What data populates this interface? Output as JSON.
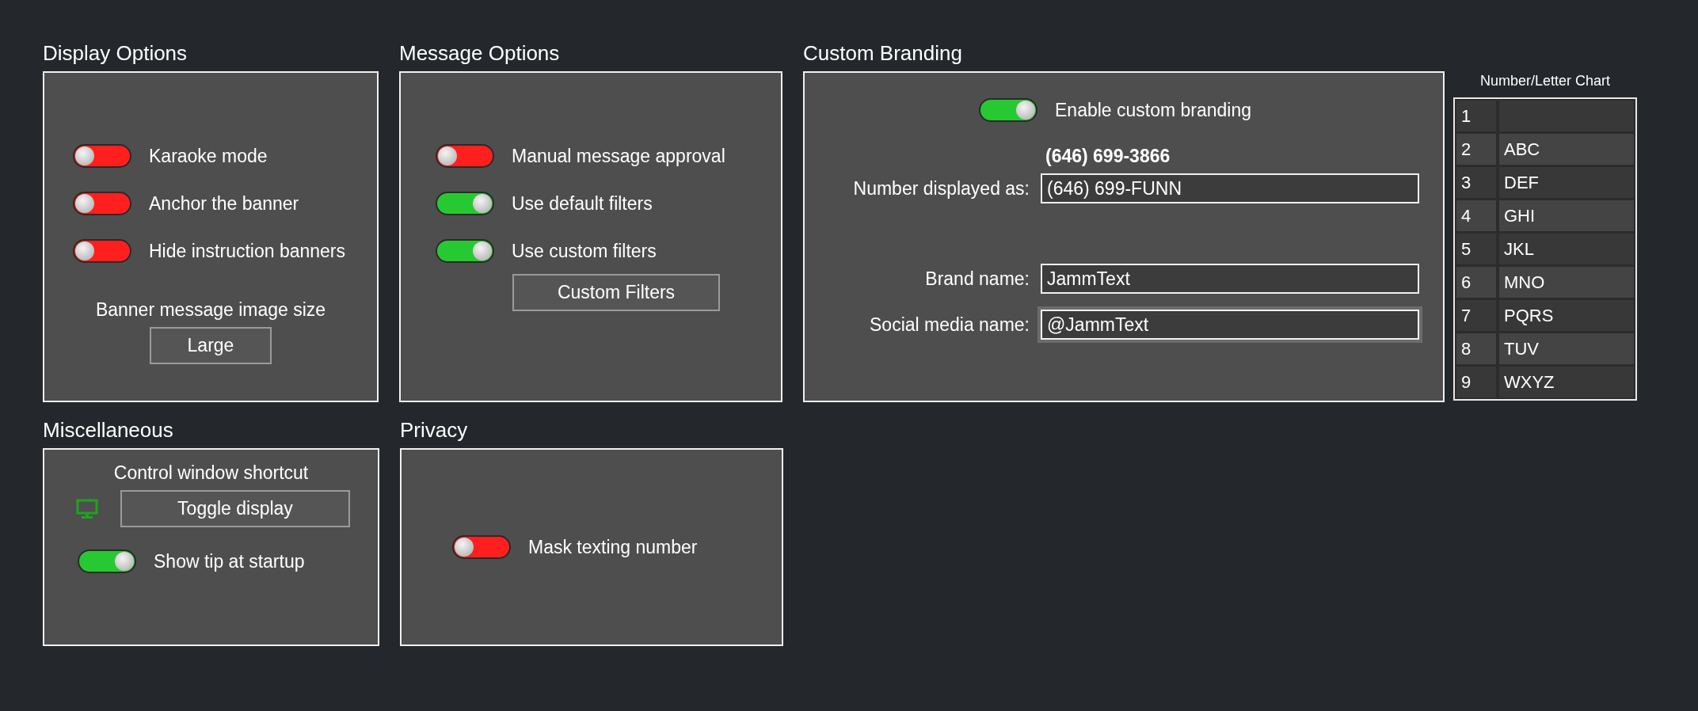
{
  "display_options": {
    "title": "Display Options",
    "toggles": [
      {
        "label": "Karaoke mode",
        "on": false
      },
      {
        "label": "Anchor the banner",
        "on": false
      },
      {
        "label": "Hide instruction banners",
        "on": false
      }
    ],
    "image_size": {
      "label": "Banner message image size",
      "button": "Large"
    }
  },
  "message_options": {
    "title": "Message Options",
    "toggles": [
      {
        "label": "Manual message approval",
        "on": false
      },
      {
        "label": "Use default filters",
        "on": true
      },
      {
        "label": "Use custom filters",
        "on": true
      }
    ],
    "button": "Custom Filters"
  },
  "custom_branding": {
    "title": "Custom Branding",
    "toggle": {
      "label": "Enable custom branding",
      "on": true
    },
    "phone_number": "(646) 699-3866",
    "fields": [
      {
        "label": "Number displayed as:",
        "value": "(646) 699-FUNN",
        "focused": false
      },
      {
        "label": "Brand name:",
        "value": "JammText",
        "focused": false
      },
      {
        "label": "Social media name:",
        "value": "@JammText",
        "focused": true
      }
    ]
  },
  "chart": {
    "title": "Number/Letter Chart",
    "rows": [
      {
        "number": "1"
      },
      {
        "number": "2",
        "letters": "ABC"
      },
      {
        "number": "3",
        "letters": "DEF"
      },
      {
        "number": "4",
        "letters": "GHI"
      },
      {
        "number": "5",
        "letters": "JKL"
      },
      {
        "number": "6",
        "letters": "MNO"
      },
      {
        "number": "7",
        "letters": "PQRS"
      },
      {
        "number": "8",
        "letters": "TUV"
      },
      {
        "number": "9",
        "letters": "WXYZ"
      }
    ]
  },
  "miscellaneous": {
    "title": "Miscellaneous",
    "shortcut_label": "Control window shortcut",
    "button": "Toggle display",
    "toggle": {
      "label": "Show tip at startup",
      "on": true
    }
  },
  "privacy": {
    "title": "Privacy",
    "toggle": {
      "label": "Mask texting number",
      "on": false
    }
  }
}
